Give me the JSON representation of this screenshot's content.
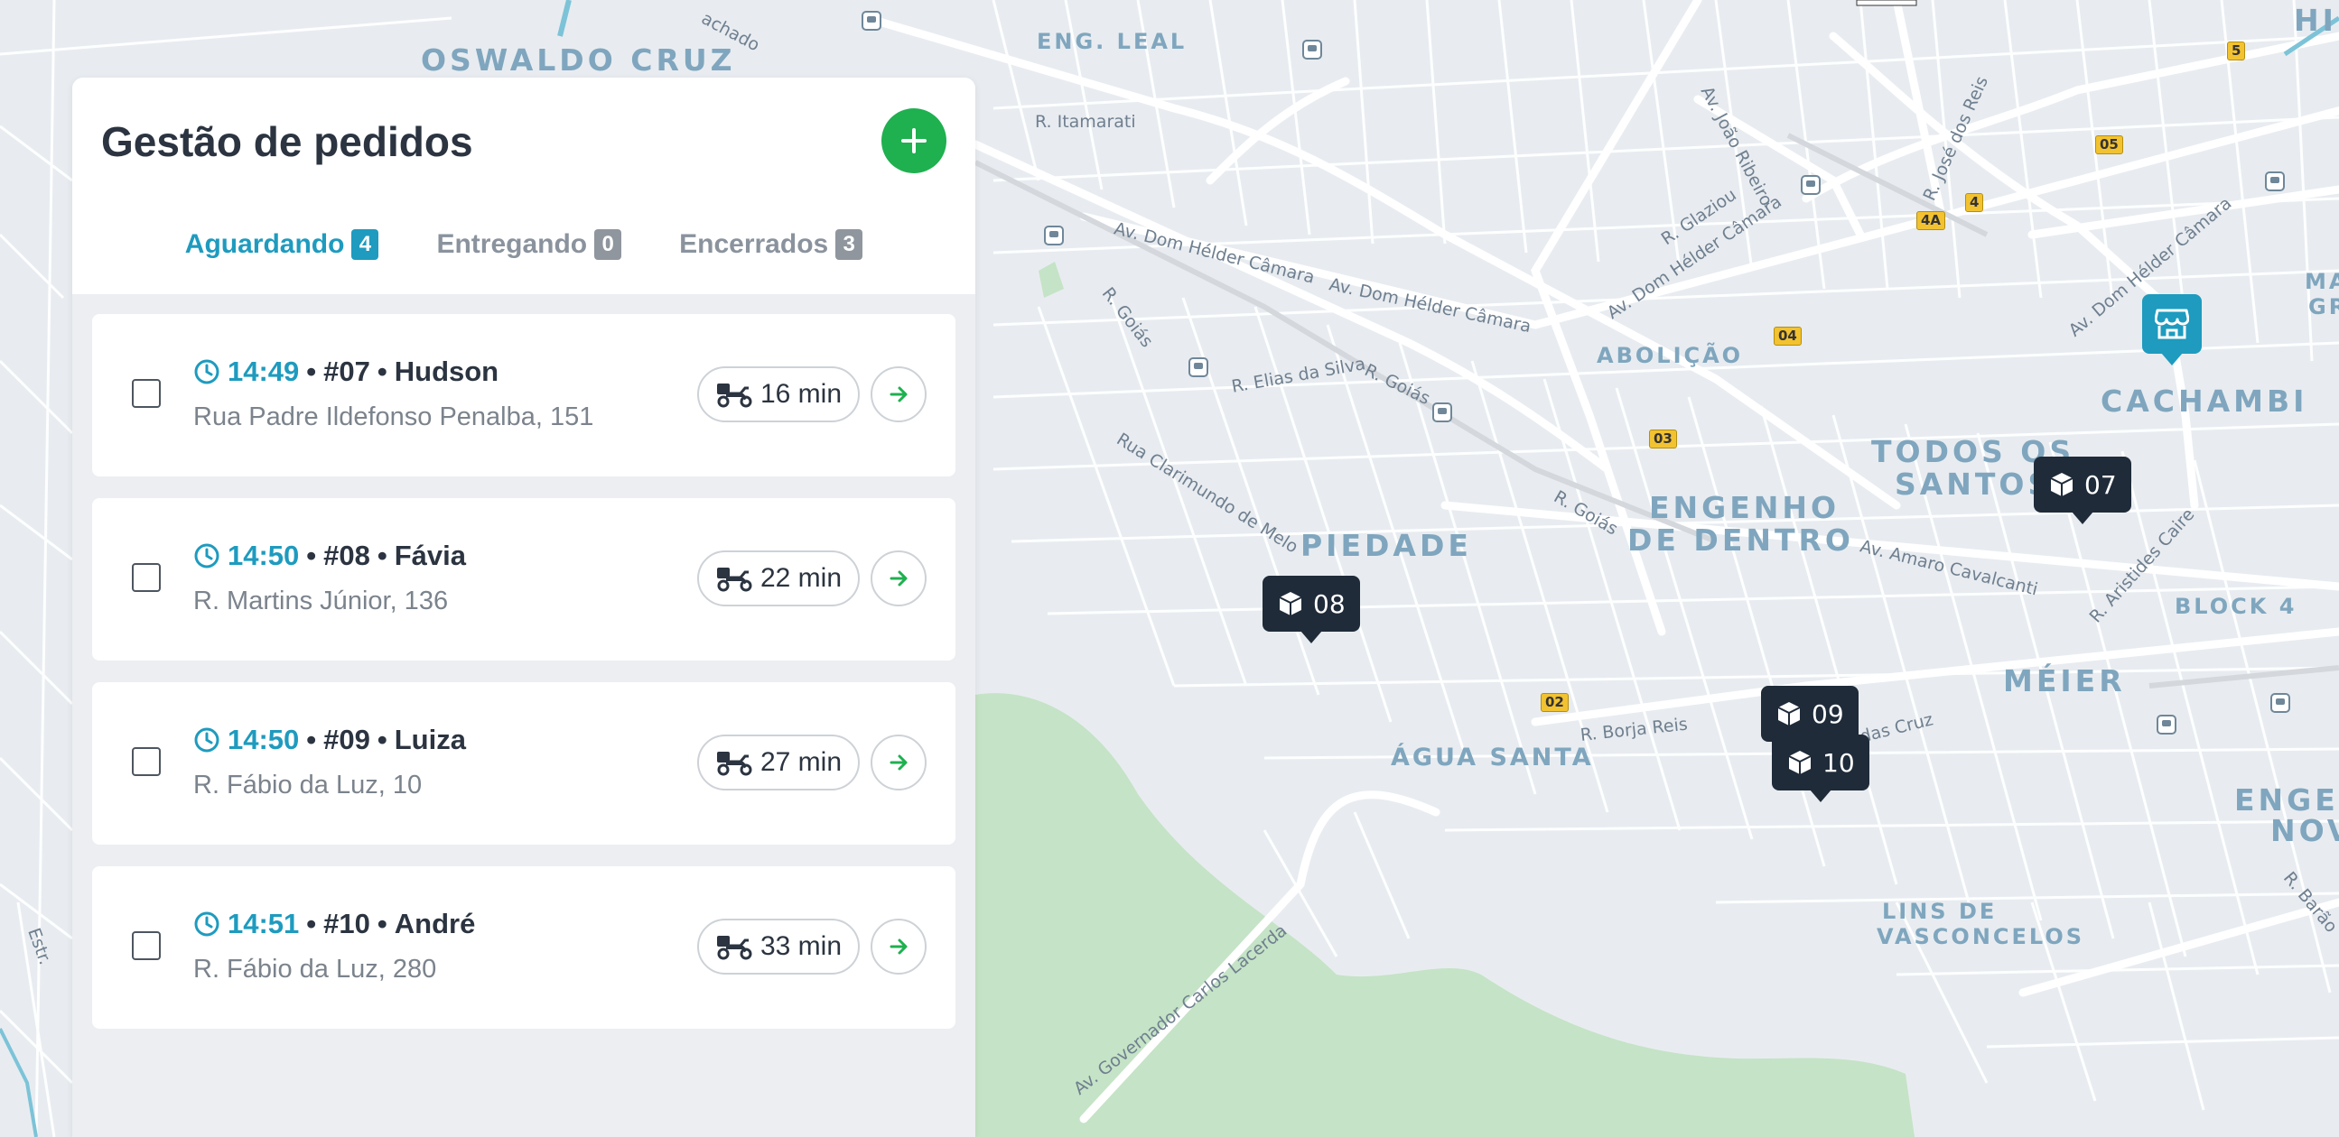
{
  "panel": {
    "title": "Gestão de pedidos",
    "add_icon": "plus-icon",
    "tabs": [
      {
        "label": "Aguardando",
        "count": "4",
        "active": true
      },
      {
        "label": "Entregando",
        "count": "0",
        "active": false
      },
      {
        "label": "Encerrados",
        "count": "3",
        "active": false
      }
    ],
    "orders": [
      {
        "time": "14:49",
        "sep1": "•",
        "number": "#07",
        "sep2": "•",
        "customer": "Hudson",
        "address": "Rua Padre Ildefonso Penalba, 151",
        "eta": "16 min"
      },
      {
        "time": "14:50",
        "sep1": "•",
        "number": "#08",
        "sep2": "•",
        "customer": "Fávia",
        "address": "R. Martins Júnior, 136",
        "eta": "22 min"
      },
      {
        "time": "14:50",
        "sep1": "•",
        "number": "#09",
        "sep2": "•",
        "customer": "Luiza",
        "address": "R. Fábio da Luz, 10",
        "eta": "27 min"
      },
      {
        "time": "14:51",
        "sep1": "•",
        "number": "#10",
        "sep2": "•",
        "customer": "André",
        "address": "R. Fábio da Luz, 280",
        "eta": "33 min"
      }
    ]
  },
  "map": {
    "neighborhoods": {
      "oswaldo_cruz": "OSWALDO CRUZ",
      "eng_leal": "ENG. LEAL",
      "abolicao": "ABOLIÇÃO",
      "cachambi": "CACHAMBI",
      "todos_os": "TODOS OS",
      "santos": "SANTOS",
      "engenho": "ENGENHO",
      "de_dentro": "DE DENTRO",
      "piedade": "PIEDADE",
      "block4": "BLOCK 4",
      "meier": "MÉIER",
      "agua_santa": "ÁGUA SANTA",
      "lins_de": "LINS DE",
      "vasconcelos": "VASCONCELOS",
      "maria": "MARIA",
      "gra": "GRA",
      "enge": "ENGE",
      "nov": "NOV",
      "hi": "HI"
    },
    "streets": {
      "chado": "achado",
      "itamarati": "R. Itamarati",
      "dom_helder1": "Av. Dom Hélder Câmara",
      "dom_helder2": "Av. Dom Hélder Câmara",
      "dom_helder3": "Av. Dom Hélder Câmara",
      "dom_helder4": "Av. Dom Hélder Câmara",
      "goias1": "R. Goiás",
      "goias2": "R. Goiás",
      "goias3": "R. Goiás",
      "elias": "R. Elias da Silva",
      "clarimundo": "Rua Clarimundo de Melo",
      "joao_ribeiro": "Av. João Ribeiro",
      "glaziou": "R. Glaziou",
      "jose_reis": "R. José dos Reis",
      "amaro": "Av. Amaro Cavalcanti",
      "aristides": "R. Aristides Caire",
      "borja": "R. Borja Reis",
      "cruz": "das Cruz",
      "carlos_lacerda": "Av. Governador Carlos Lacerda",
      "barao": "R. Barão",
      "estr": "Estr."
    },
    "road_shields": [
      "5",
      "05",
      "4A",
      "4",
      "04",
      "03",
      "02"
    ],
    "order_pins": [
      {
        "label": "07",
        "icon": "package-icon"
      },
      {
        "label": "08",
        "icon": "package-icon"
      },
      {
        "label": "09",
        "icon": "package-icon"
      },
      {
        "label": "10",
        "icon": "package-icon"
      }
    ],
    "store_icon": "store-icon",
    "colors": {
      "accent": "#1e9bbf",
      "green": "#1fb050",
      "pin": "#1f2b39",
      "park": "#c5e3c6"
    }
  }
}
